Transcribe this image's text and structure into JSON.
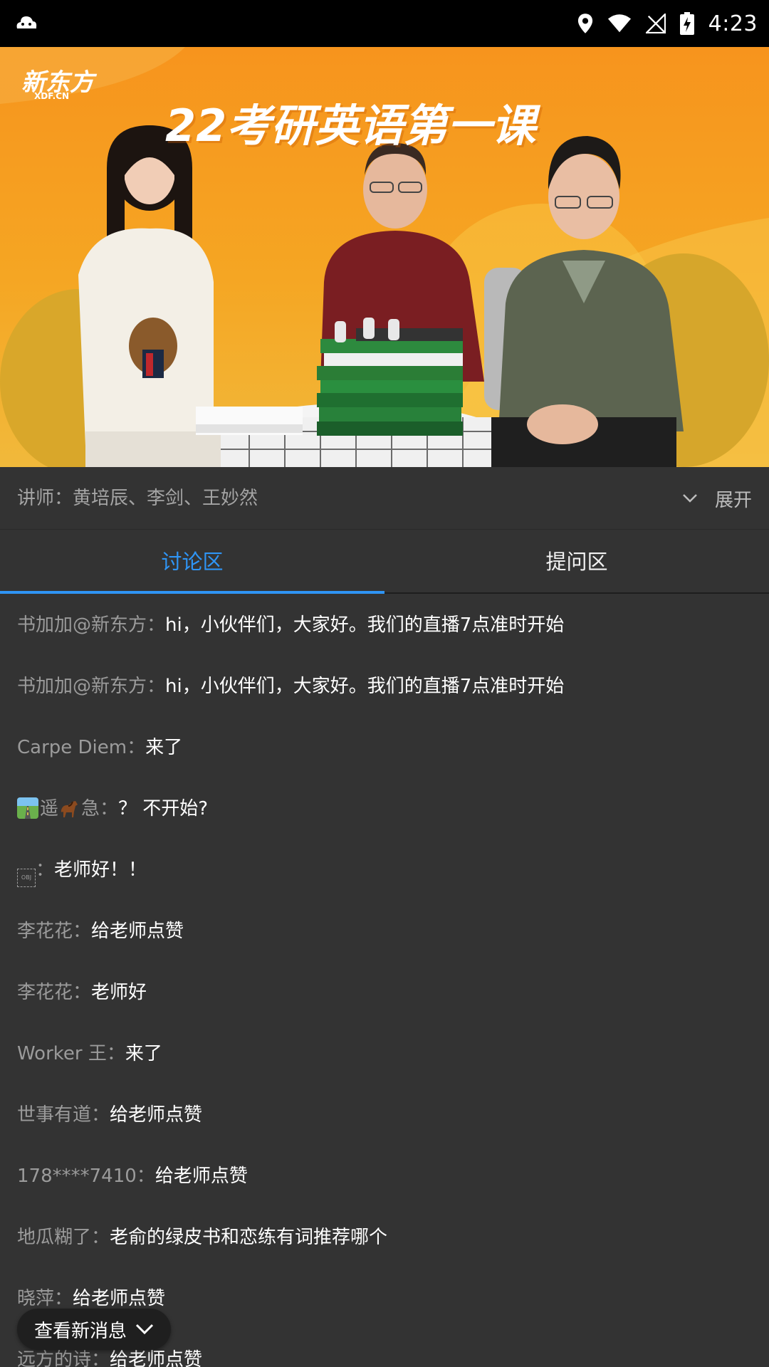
{
  "status_bar": {
    "time": "4:23",
    "icons": [
      "cloud-icon",
      "location-icon",
      "wifi-icon",
      "no-signal-icon",
      "battery-charging-icon"
    ]
  },
  "video": {
    "brand": "新东方",
    "brand_sub": "XDF.CN",
    "course_title": "22考研英语第一课"
  },
  "lecturer": {
    "text": "讲师：黄培辰、李剑、王妙然",
    "expand_label": "展开",
    "expand_icon": "chevron-down-icon"
  },
  "tabs": [
    {
      "label": "讨论区",
      "active": true
    },
    {
      "label": "提问区",
      "active": false
    }
  ],
  "accent_color": "#2f95f5",
  "messages": [
    {
      "name": "书加加@新东方",
      "sep": "：",
      "content": "hi，小伙伴们，大家好。我们的直播7点准时开始"
    },
    {
      "name": "书加加@新东方",
      "sep": "：",
      "content": "hi，小伙伴们，大家好。我们的直播7点准时开始"
    },
    {
      "name": "Carpe Diem",
      "sep": "：",
      "content": "来了"
    },
    {
      "name": "遥",
      "name2": "急",
      "sep": "：",
      "content": "？ 不开始?",
      "emoji": [
        "road-emoji",
        "horse-emoji"
      ]
    },
    {
      "name": "",
      "sep": "：",
      "content": "老师好！！",
      "obj": "OBJ"
    },
    {
      "name": "李花花",
      "sep": "：",
      "content": "给老师点赞"
    },
    {
      "name": "李花花",
      "sep": "：",
      "content": "老师好"
    },
    {
      "name": "Worker 王",
      "sep": "：",
      "content": "来了"
    },
    {
      "name": "世事有道",
      "sep": "：",
      "content": "给老师点赞"
    },
    {
      "name": "178****7410",
      "sep": "：",
      "content": "给老师点赞"
    },
    {
      "name": "地瓜糊了",
      "sep": "：",
      "content": "老俞的绿皮书和恋练有词推荐哪个"
    },
    {
      "name": "晓萍",
      "sep": "：",
      "content": "给老师点赞"
    },
    {
      "name": "远方的诗",
      "sep": "：",
      "content": "给老师点赞"
    }
  ],
  "new_message_button": {
    "label": "查看新消息",
    "icon": "chevron-down-icon"
  }
}
